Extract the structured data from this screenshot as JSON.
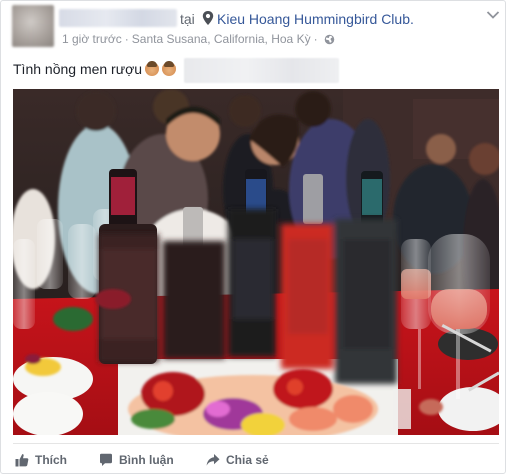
{
  "header": {
    "at_text": "tại",
    "place": "Kieu Hoang Hummingbird Club.",
    "time": "1 giờ trước",
    "separator": "·",
    "location": "Santa Susana, California, Hoa Kỳ",
    "icons": [
      "map-pin-icon",
      "chevron-down-icon",
      "globe-icon"
    ]
  },
  "post": {
    "caption": "Tình nồng men rượu"
  },
  "actions": {
    "like": "Thích",
    "comment": "Bình luận",
    "share": "Chia sẻ"
  },
  "colors": {
    "link": "#365899",
    "secondary_text": "#90949c",
    "action_text": "#616770",
    "border": "#dddfe2"
  }
}
